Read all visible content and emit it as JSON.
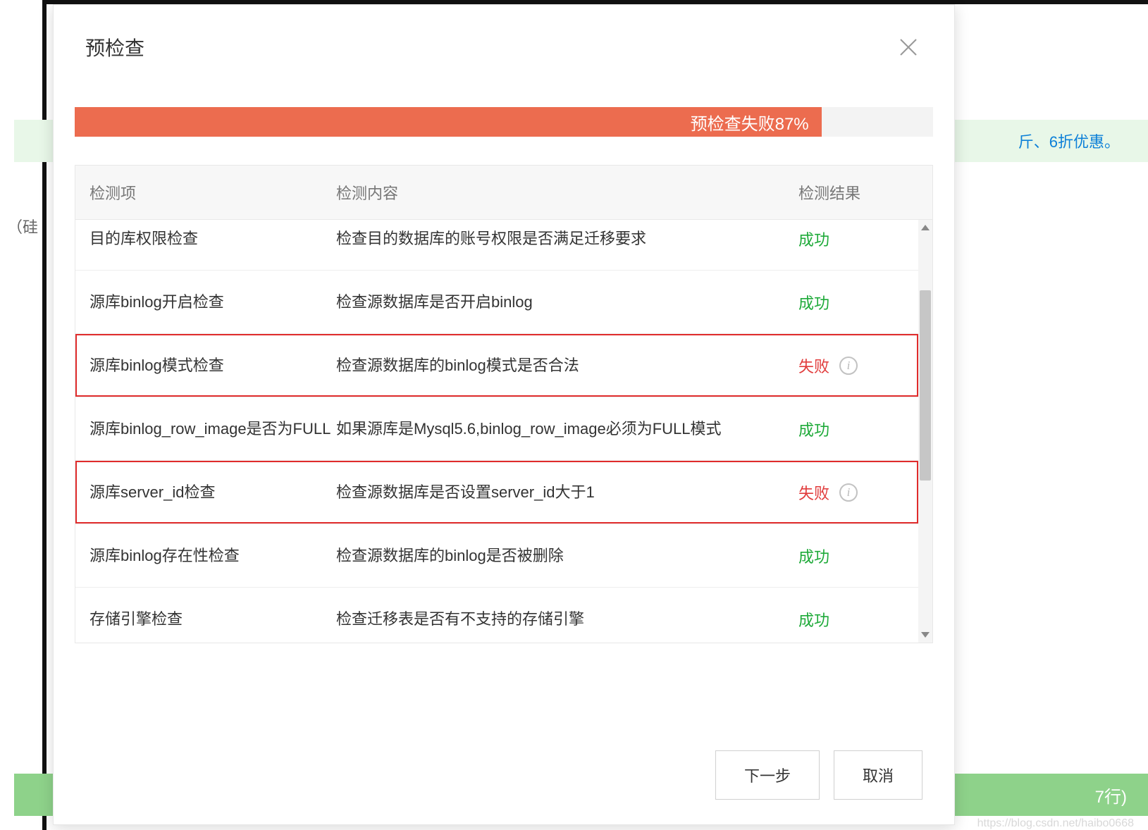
{
  "modal": {
    "title": "预检查",
    "progress_text": "预检查失败87%",
    "progress_percent": 87
  },
  "table": {
    "headers": {
      "item": "检测项",
      "content": "检测内容",
      "result": "检测结果"
    },
    "rows": [
      {
        "item": "目的库权限检查",
        "content": "检查目的数据库的账号权限是否满足迁移要求",
        "result": "成功",
        "status": "success",
        "highlight": false,
        "info": false
      },
      {
        "item": "源库binlog开启检查",
        "content": "检查源数据库是否开启binlog",
        "result": "成功",
        "status": "success",
        "highlight": false,
        "info": false
      },
      {
        "item": "源库binlog模式检查",
        "content": "检查源数据库的binlog模式是否合法",
        "result": "失败",
        "status": "fail",
        "highlight": true,
        "info": true
      },
      {
        "item": "源库binlog_row_image是否为FULL",
        "content": "如果源库是Mysql5.6,binlog_row_image必须为FULL模式",
        "result": "成功",
        "status": "success",
        "highlight": false,
        "info": false
      },
      {
        "item": "源库server_id检查",
        "content": "检查源数据库是否设置server_id大于1",
        "result": "失败",
        "status": "fail",
        "highlight": true,
        "info": true
      },
      {
        "item": "源库binlog存在性检查",
        "content": "检查源数据库的binlog是否被删除",
        "result": "成功",
        "status": "success",
        "highlight": false,
        "info": false
      },
      {
        "item": "存储引擎检查",
        "content": "检查迁移表是否有不支持的存储引擎",
        "result": "成功",
        "status": "success",
        "highlight": false,
        "info": false
      }
    ]
  },
  "footer": {
    "next": "下一步",
    "cancel": "取消"
  },
  "background": {
    "discount_text": "斤、6折优惠。",
    "side_text": "（硅",
    "success_text": "7行)",
    "watermark": "https://blog.csdn.net/haibo0668"
  }
}
